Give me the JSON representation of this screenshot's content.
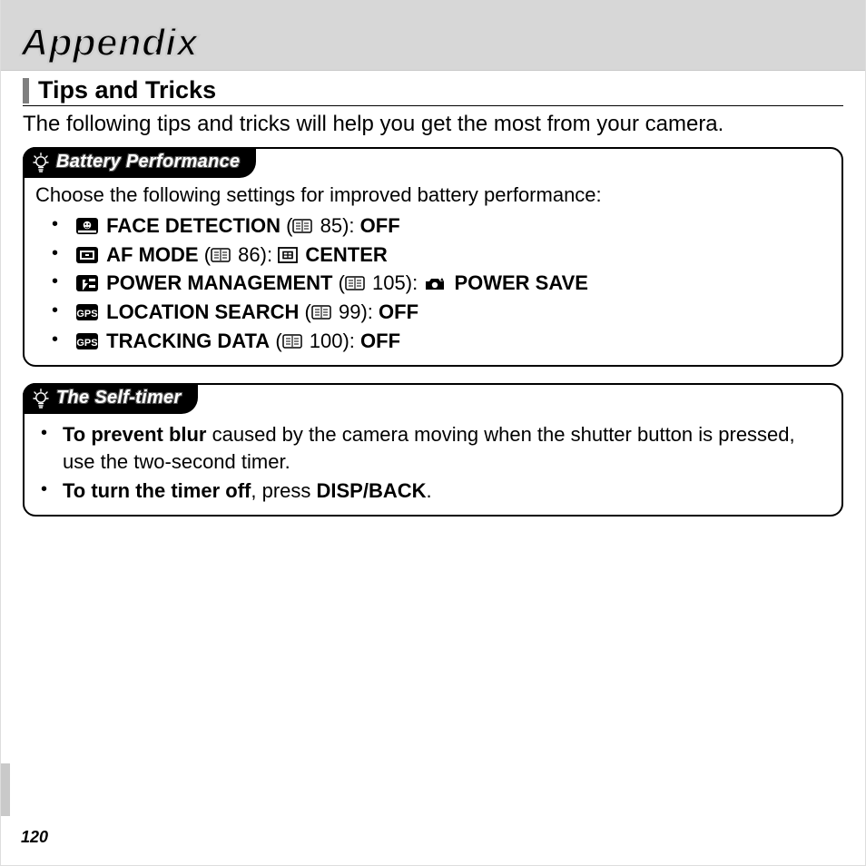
{
  "header": {
    "title": "Appendix"
  },
  "section": {
    "title": "Tips and Tricks",
    "intro": "The following tips and tricks will help you get the most from your camera."
  },
  "tips": {
    "battery": {
      "tab": "Battery Performance",
      "intro": "Choose the following settings for improved battery performance:",
      "items": [
        {
          "name": "FACE DETECTION",
          "page": "85",
          "value": "OFF"
        },
        {
          "name": "AF MODE",
          "page": "86",
          "value": "CENTER"
        },
        {
          "name": "POWER MANAGEMENT",
          "page": "105",
          "value": "POWER SAVE"
        },
        {
          "name": "LOCATION SEARCH",
          "page": "99",
          "value": "OFF"
        },
        {
          "name": "TRACKING DATA",
          "page": "100",
          "value": "OFF"
        }
      ]
    },
    "selftimer": {
      "tab": "The Self-timer",
      "items": [
        {
          "lead": "To prevent blur",
          "rest": " caused by the camera moving when the shutter button is pressed, use the two-second timer."
        },
        {
          "lead": "To turn the timer off",
          "rest": ", press ",
          "tail": "DISP/BACK",
          "end": "."
        }
      ]
    }
  },
  "pageNumber": "120"
}
